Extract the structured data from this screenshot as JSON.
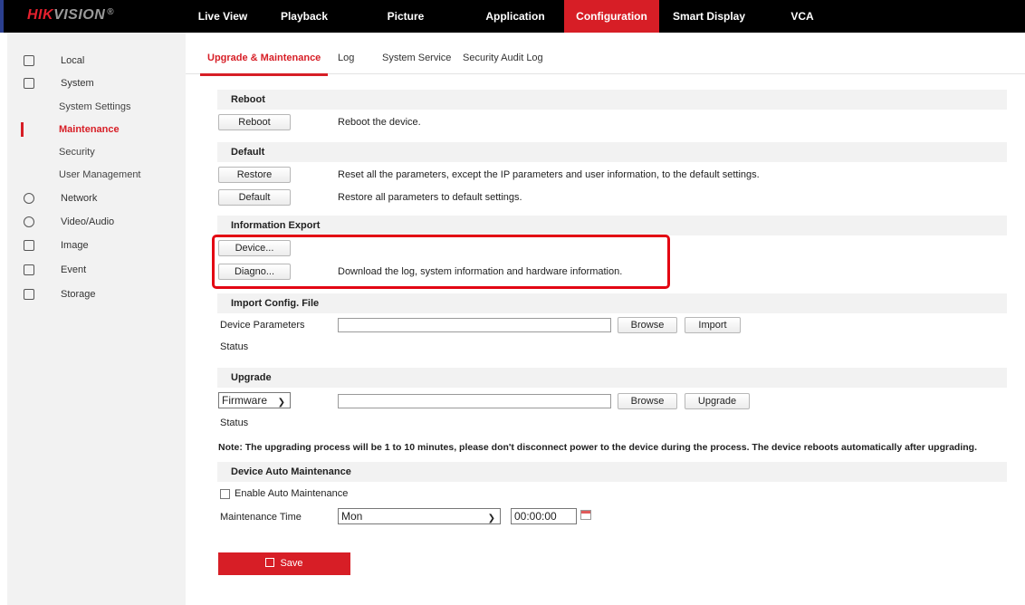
{
  "brand": {
    "hik": "HIK",
    "vision": "VISION",
    "mark": "®"
  },
  "nav": {
    "live_view": "Live View",
    "playback": "Playback",
    "picture": "Picture",
    "application": "Application",
    "configuration": "Configuration",
    "smart_display": "Smart Display",
    "vca": "VCA"
  },
  "sidebar": {
    "local": "Local",
    "system": "System",
    "system_settings": "System Settings",
    "maintenance": "Maintenance",
    "security": "Security",
    "user_management": "User Management",
    "network": "Network",
    "video_audio": "Video/Audio",
    "image": "Image",
    "event": "Event",
    "storage": "Storage"
  },
  "subtabs": {
    "upgrade": "Upgrade & Maintenance",
    "log": "Log",
    "system_service": "System Service",
    "security_audit": "Security Audit Log"
  },
  "reboot": {
    "title": "Reboot",
    "button": "Reboot",
    "desc": "Reboot the device."
  },
  "default": {
    "title": "Default",
    "restore_button": "Restore",
    "restore_desc": "Reset all the parameters, except the IP parameters and user information, to the default settings.",
    "default_button": "Default",
    "default_desc": "Restore all parameters to default settings."
  },
  "export": {
    "title": "Information Export",
    "device_button": "Device...",
    "diagno_button": "Diagno...",
    "diagno_desc": "Download the log, system information and hardware information."
  },
  "import": {
    "title": "Import Config. File",
    "label": "Device Parameters",
    "browse": "Browse",
    "import_button": "Import",
    "status": "Status",
    "path_value": ""
  },
  "upgrade": {
    "title": "Upgrade",
    "select_value": "Firmware",
    "browse": "Browse",
    "upgrade_button": "Upgrade",
    "status": "Status",
    "path_value": "",
    "note": "Note: The upgrading process will be 1 to 10 minutes, please don't disconnect power to the device during the process. The device reboots automatically after upgrading."
  },
  "auto": {
    "title": "Device Auto Maintenance",
    "enable_label": "Enable Auto Maintenance",
    "enabled": false,
    "time_label": "Maintenance Time",
    "day_value": "Mon",
    "time_value": "00:00:00"
  },
  "save": {
    "label": "Save"
  },
  "colors": {
    "accent": "#d71e26",
    "topbar": "#000000",
    "highlight": "#e30613"
  }
}
